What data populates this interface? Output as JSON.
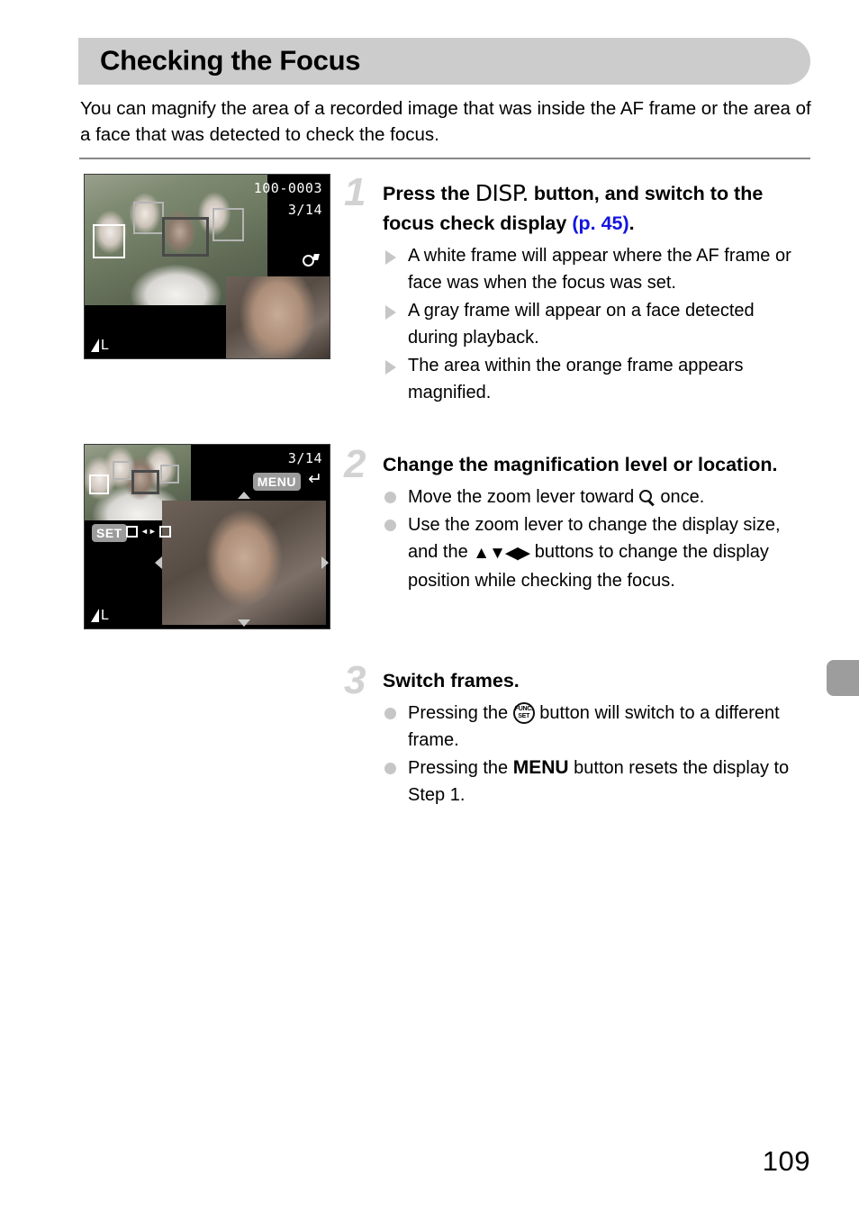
{
  "page": {
    "title": "Checking the Focus",
    "number": "109",
    "intro": "You can magnify the area of a recorded image that was inside the AF frame or the area of a face that was detected to check the focus."
  },
  "steps": [
    {
      "number": "1",
      "heading_before": "Press the",
      "heading_glyph": "DISP.",
      "heading_middle": "button, and switch to the focus check display",
      "heading_pageref": "(p. 45)",
      "heading_after": ".",
      "bullets": [
        {
          "marker": "triangle",
          "text": "A white frame will appear where the AF frame or face was when the focus was set."
        },
        {
          "marker": "triangle",
          "text": "A gray frame will appear on a face detected during playback."
        },
        {
          "marker": "triangle",
          "text": "The area within the orange frame appears magnified."
        }
      ]
    },
    {
      "number": "2",
      "heading": "Change the magnification level or location.",
      "bullets": [
        {
          "marker": "dot",
          "text_before": "Move the zoom lever toward",
          "glyph": "magnifier-icon",
          "text_after": "once."
        },
        {
          "marker": "dot",
          "text_before": "Use the zoom lever to change the display size, and the",
          "glyph": "direction-pad",
          "text_after": "buttons to change the display position while checking the focus."
        }
      ]
    },
    {
      "number": "3",
      "heading": "Switch frames.",
      "bullets": [
        {
          "marker": "dot",
          "text_before": "Pressing the",
          "glyph": "func-set-icon",
          "text_after": "button will switch to a different frame."
        },
        {
          "marker": "dot",
          "text_before": "Pressing the",
          "glyph": "MENU",
          "text_after": "button resets the display to Step 1."
        }
      ]
    }
  ],
  "screens": [
    {
      "name": "focus-check-display",
      "file_number": "100-0003",
      "frame_counter": "3/14",
      "magnify_icon": "magnifier-icon",
      "quality_label": "L",
      "af_frames": [
        "white",
        "gray",
        "gray",
        "orange",
        "gray"
      ]
    },
    {
      "name": "magnified-focus-check-display",
      "frame_counter": "3/14",
      "menu_badge": "MENU",
      "menu_action_icon": "return-arrow-icon",
      "set_badge": "SET",
      "set_action_icon": "swap-frame-icon",
      "quality_label": "L",
      "scroll_icons": [
        "up-arrow",
        "down-arrow",
        "left-arrow",
        "right-arrow"
      ]
    }
  ],
  "colors": {
    "header_band": "#cccccc",
    "step_number": "#d2d2d2",
    "page_reference_link": "#1414e0",
    "chapter_tab": "#9d9d9d",
    "bullet_marker": "#c6c6c6"
  }
}
